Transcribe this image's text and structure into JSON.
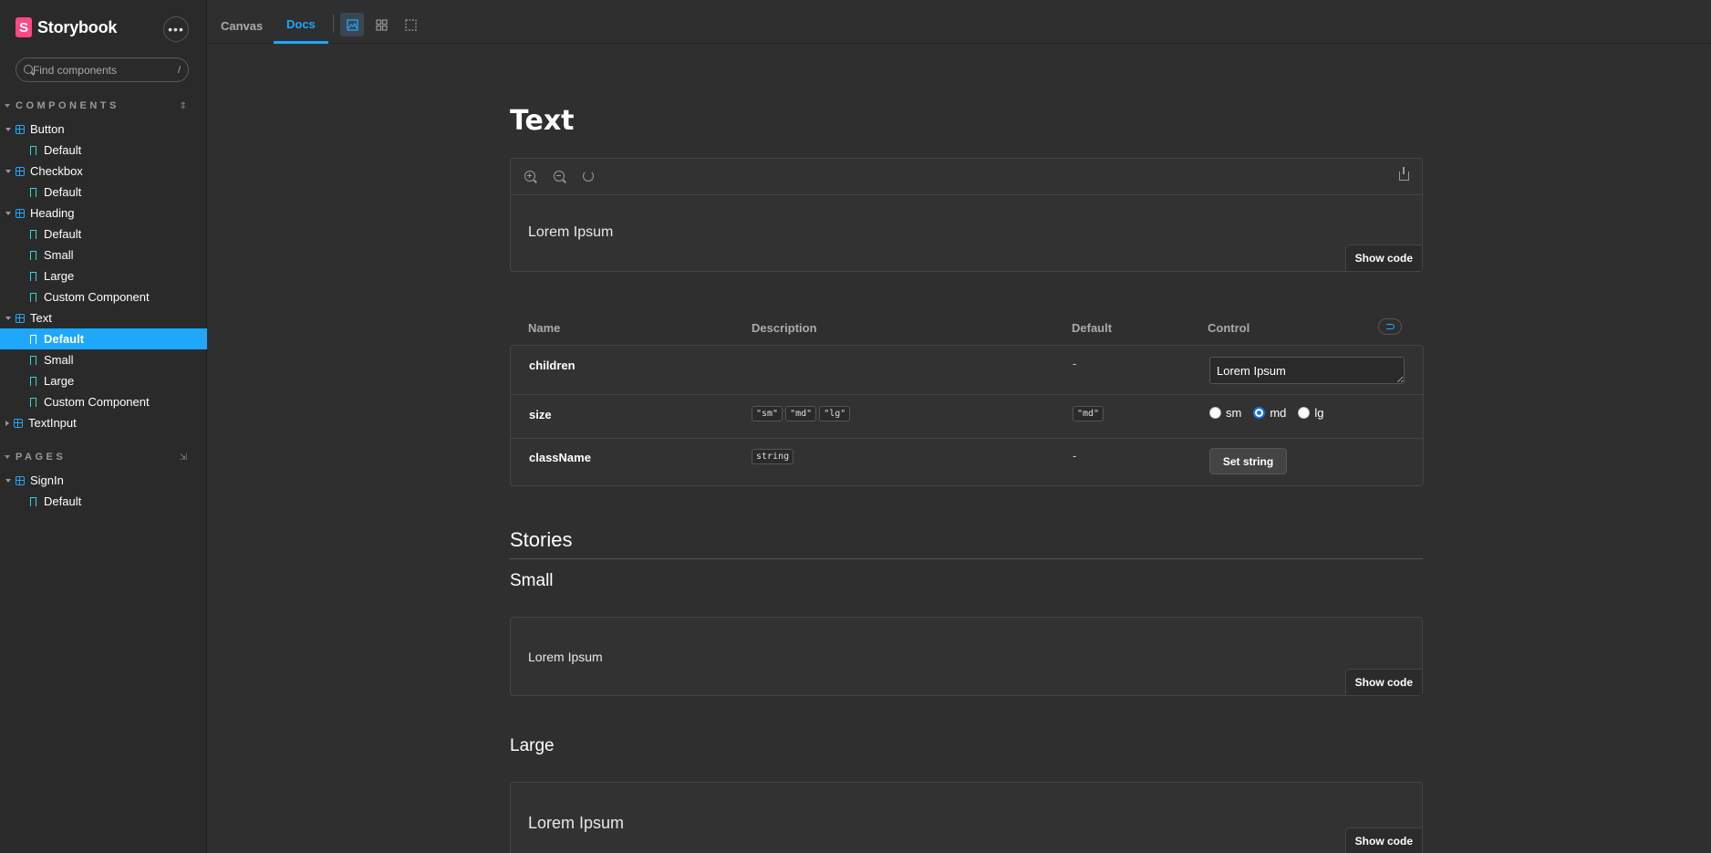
{
  "app": {
    "name": "Storybook",
    "logo_letter": "S",
    "menu_label": "•••"
  },
  "search": {
    "placeholder": "Find components",
    "shortcut": "/"
  },
  "sidebar": {
    "components_title": "COMPONENTS",
    "pages_title": "PAGES",
    "components": [
      {
        "label": "Button",
        "stories": [
          "Default"
        ]
      },
      {
        "label": "Checkbox",
        "stories": [
          "Default"
        ]
      },
      {
        "label": "Heading",
        "stories": [
          "Default",
          "Small",
          "Large",
          "Custom Component"
        ]
      },
      {
        "label": "Text",
        "stories": [
          "Default",
          "Small",
          "Large",
          "Custom Component"
        ]
      },
      {
        "label": "TextInput",
        "stories": []
      }
    ],
    "pages": [
      {
        "label": "SignIn",
        "stories": [
          "Default"
        ]
      }
    ],
    "selected": "Text / Default"
  },
  "toolbar": {
    "tabs": [
      "Canvas",
      "Docs"
    ],
    "active_tab": "Docs",
    "icons": [
      "image-icon",
      "grid-icon",
      "outline-icon"
    ]
  },
  "docs": {
    "title": "Text",
    "primary_preview_text": "Lorem Ipsum",
    "show_code_label": "Show code",
    "args_table": {
      "headers": [
        "Name",
        "Description",
        "Default",
        "Control"
      ],
      "rows": [
        {
          "name": "children",
          "description": [],
          "default": "-",
          "control_value": "Lorem Ipsum"
        },
        {
          "name": "size",
          "description": [
            "\"sm\"",
            "\"md\"",
            "\"lg\""
          ],
          "default": "\"md\"",
          "options": [
            "sm",
            "md",
            "lg"
          ],
          "selected": "md"
        },
        {
          "name": "className",
          "description": [
            "string"
          ],
          "default": "-",
          "control_button": "Set string"
        }
      ]
    },
    "stories_heading": "Stories",
    "stories": [
      {
        "name": "Small",
        "preview_text": "Lorem Ipsum"
      },
      {
        "name": "Large",
        "preview_text": "Lorem Ipsum"
      }
    ]
  },
  "colors": {
    "accent": "#1ea7fd",
    "story": "#37d5d3",
    "brand": "#ff4785"
  }
}
